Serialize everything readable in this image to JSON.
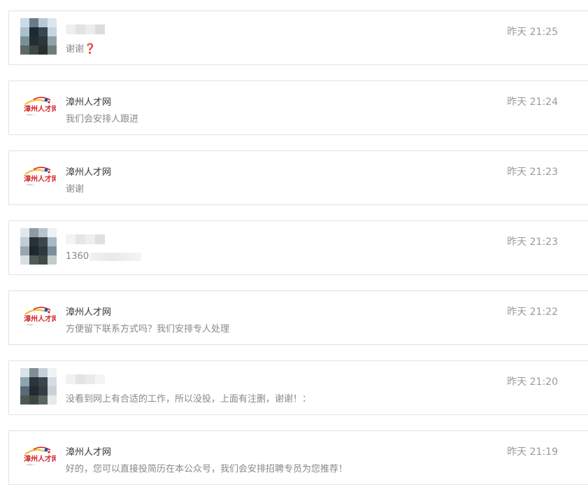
{
  "messages": [
    {
      "sender": "",
      "avatar": "blurred-user-avatar",
      "preview": "谢谢",
      "preview_suffix": "❓",
      "time": "昨天 21:25"
    },
    {
      "sender": "漳州人才网",
      "avatar": "zhangzhou-rencai-logo",
      "preview": "我们会安排人跟进",
      "time": "昨天 21:24"
    },
    {
      "sender": "漳州人才网",
      "avatar": "zhangzhou-rencai-logo",
      "preview": "谢谢",
      "time": "昨天 21:23"
    },
    {
      "sender": "",
      "avatar": "blurred-user-avatar",
      "preview": "1360",
      "time": "昨天 21:23"
    },
    {
      "sender": "漳州人才网",
      "avatar": "zhangzhou-rencai-logo",
      "preview": "方便留下联系方式吗？我们安排专人处理",
      "time": "昨天 21:22"
    },
    {
      "sender": "",
      "avatar": "blurred-user-avatar",
      "preview": "没看到网上有合适的工作，所以没投，上面有注删，谢谢！：",
      "time": "昨天 21:20"
    },
    {
      "sender": "漳州人才网",
      "avatar": "zhangzhou-rencai-logo",
      "preview": "好的，您可以直接投简历在本公众号，我们会安排招聘专员为您推荐！",
      "time": "昨天 21:19"
    }
  ],
  "logo_text": "漳州人才网",
  "colors": {
    "logo_red": "#d8262b",
    "logo_blue": "#1f4fa0",
    "logo_yellow": "#f2b81c",
    "time": "#9a9a9a",
    "preview": "#888888",
    "name": "#333333",
    "border": "#e3e3e3"
  }
}
